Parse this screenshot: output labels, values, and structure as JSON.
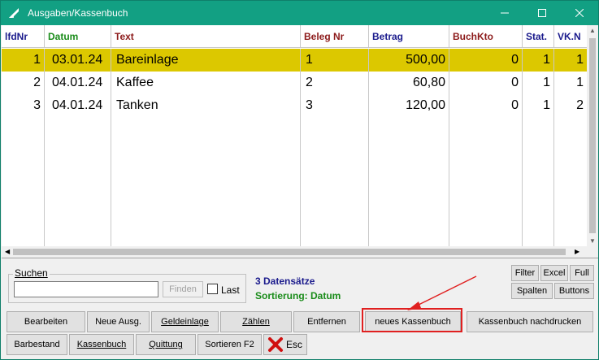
{
  "window": {
    "title": "Ausgaben/Kassenbuch"
  },
  "columns": [
    {
      "label": "lfdNr",
      "color": "#1a1a8c"
    },
    {
      "label": "Datum",
      "color": "#1a8c1a"
    },
    {
      "label": "Text",
      "color": "#8c1a1a"
    },
    {
      "label": "Beleg Nr",
      "color": "#8c1a1a"
    },
    {
      "label": "Betrag",
      "color": "#1a1a8c"
    },
    {
      "label": "BuchKto",
      "color": "#8c1a1a"
    },
    {
      "label": "Stat.",
      "color": "#1a1a8c"
    },
    {
      "label": "VK.N",
      "color": "#1a1a8c"
    }
  ],
  "rows": [
    {
      "lfdnr": "1",
      "datum": "03.01.24",
      "text": "Bareinlage",
      "beleg": "1",
      "betrag": "500,00",
      "buchkto": "0",
      "stat": "1",
      "vk": "1",
      "selected": true
    },
    {
      "lfdnr": "2",
      "datum": "04.01.24",
      "text": "Kaffee",
      "beleg": "2",
      "betrag": "60,80",
      "buchkto": "0",
      "stat": "1",
      "vk": "1",
      "selected": false
    },
    {
      "lfdnr": "3",
      "datum": "04.01.24",
      "text": "Tanken",
      "beleg": "3",
      "betrag": "120,00",
      "buchkto": "0",
      "stat": "1",
      "vk": "2",
      "selected": false
    }
  ],
  "search": {
    "legend": "Suchen",
    "value": "",
    "find_label": "Finden",
    "last_label": "Last"
  },
  "info": {
    "records": "3 Datensätze",
    "sort": "Sortierung: Datum"
  },
  "right_buttons": {
    "filter": "Filter",
    "excel": "Excel",
    "full": "Full",
    "spalten": "Spalten",
    "buttons": "Buttons"
  },
  "buttons_row1": {
    "bearbeiten": "Bearbeiten",
    "neue_ausg": "Neue Ausg.",
    "geldeinlage": "Geldeinlage",
    "zaehlen": "Zählen",
    "entfernen": "Entfernen",
    "neues_kassenbuch": "neues Kassenbuch",
    "nachdrucken": "Kassenbuch nachdrucken"
  },
  "buttons_row2": {
    "barbestand": "Barbestand",
    "kassenbuch": "Kassenbuch",
    "quittung": "Quittung",
    "sortieren": "Sortieren F2",
    "esc": "Esc"
  },
  "colors": {
    "titlebar": "#12a083",
    "selected_row": "#dcc800",
    "highlight": "#e02020"
  }
}
